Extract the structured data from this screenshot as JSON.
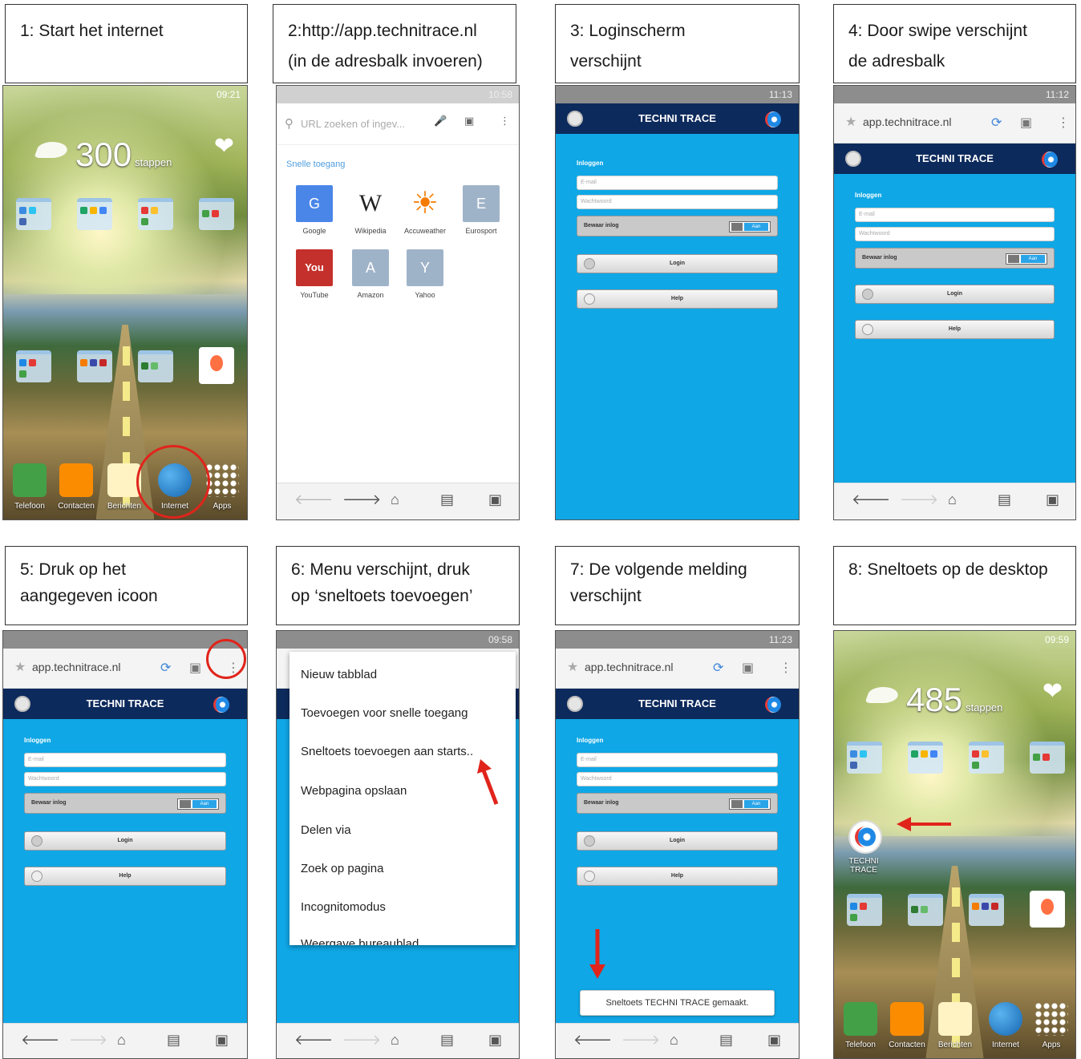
{
  "captions": {
    "c1": "1: Start het internet",
    "c2_line1": "2:http://app.technitrace.nl",
    "c2_line2": "(in de adresbalk invoeren)",
    "c3_line1": "3: Loginscherm",
    "c3_line2": "verschijnt",
    "c4_line1": "4: Door swipe verschijnt",
    "c4_line2": "de adresbalk",
    "c5_line1": "5: Druk op het",
    "c5_line2": "aangegeven icoon",
    "c6_line1": "6: Menu verschijnt, druk",
    "c6_line2": "op ‘sneltoets toevoegen’",
    "c7_line1": "7: De volgende melding",
    "c7_line2": "verschijnt",
    "c8": "8: Sneltoets op de desktop"
  },
  "home1": {
    "time": "09:21",
    "steps": "300",
    "steps_unit": "stappen",
    "dock": [
      "Telefoon",
      "Contacten",
      "Berichten",
      "Internet",
      "Apps"
    ]
  },
  "home8": {
    "time": "09:59",
    "steps": "485",
    "steps_unit": "stappen",
    "shortcut_label": "TECHNI TRACE",
    "dock": [
      "Telefoon",
      "Contacten",
      "Berichten",
      "Internet",
      "Apps"
    ]
  },
  "browser2": {
    "time": "10:58",
    "search_placeholder": "URL zoeken of ingev...",
    "quick_access": "Snelle toegang",
    "tiles": [
      {
        "letter": "G",
        "label": "Google",
        "color": "#4a86e8"
      },
      {
        "letter": "W",
        "label": "Wikipedia",
        "color": "#ffffff"
      },
      {
        "letter": "☀",
        "label": "Accuweather",
        "color": "#ffffff"
      },
      {
        "letter": "E",
        "label": "Eurosport",
        "color": "#9fb3c8"
      },
      {
        "letter": "You",
        "label": "YouTube",
        "color": "#c4302b"
      },
      {
        "letter": "A",
        "label": "Amazon",
        "color": "#9fb3c8"
      },
      {
        "letter": "Y",
        "label": "Yahoo",
        "color": "#9fb3c8"
      }
    ]
  },
  "app": {
    "url": "app.technitrace.nl",
    "title": "TECHNI TRACE",
    "login_heading": "Inloggen",
    "email_placeholder": "E-mail",
    "password_placeholder": "Wachtwoord",
    "remember": "Bewaar inlog",
    "toggle_text": "Aan",
    "login_button": "Login",
    "help_button": "Help"
  },
  "menu6": {
    "time": "09:58",
    "items": [
      "Nieuw tabblad",
      "Toevoegen voor snelle toegang",
      "Sneltoets toevoegen aan starts..",
      "Webpagina opslaan",
      "Delen via",
      "Zoek op pagina",
      "Incognitomodus",
      "Weergave bureaublad"
    ]
  },
  "toast7": {
    "time": "11:23",
    "message": "Sneltoets TECHNI TRACE gemaakt."
  },
  "times": {
    "s3": "11:13",
    "s4": "11:12",
    "s5": ""
  },
  "colors": {
    "accent_red": "#e0241b",
    "app_blue": "#0fa7e6",
    "header_navy": "#0d2a5c"
  }
}
